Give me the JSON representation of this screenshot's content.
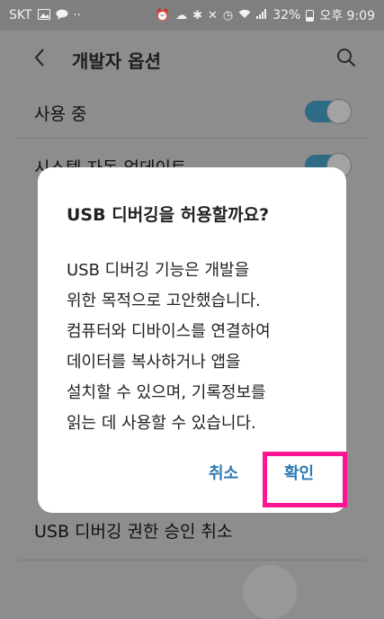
{
  "status_bar": {
    "carrier": "SKT",
    "left_icons": [
      "image-icon",
      "chat-icon",
      "dots-icon"
    ],
    "right_icons": [
      "alarm-icon",
      "cloud-icon",
      "bluetooth-icon",
      "mute-icon",
      "clock-icon",
      "wifi-icon",
      "signal-icon"
    ],
    "battery_percent": "32%",
    "time": "오후 9:09"
  },
  "app_bar": {
    "title": "개발자 옵션",
    "back_icon": "chevron-left-icon",
    "search_icon": "search-icon"
  },
  "settings": [
    {
      "label": "사용 중",
      "toggle_on": true
    },
    {
      "label": "시스템 자동 업데이트",
      "toggle_on": true
    },
    {
      "label": "USB 디버깅 권한 승인 취소"
    }
  ],
  "dialog": {
    "title": "USB 디버깅을 허용할까요?",
    "message_lines": [
      "USB 디버깅 기능은 개발을",
      "위한 목적으로 고안했습니다.",
      "컴퓨터와 디바이스를 연결하여",
      "데이터를 복사하거나 앱을",
      "설치할 수 있으며, 기록정보를",
      "읽는 데 사용할 수 있습니다."
    ],
    "cancel_label": "취소",
    "confirm_label": "확인"
  },
  "colors": {
    "accent": "#2f7ab3",
    "highlight": "#ff1493",
    "toggle_on": "#2f6a86"
  }
}
